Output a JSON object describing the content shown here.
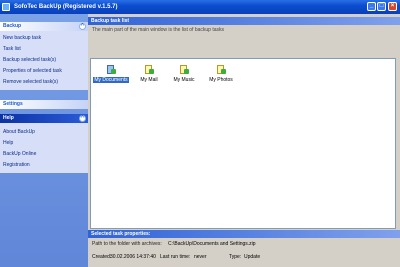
{
  "window": {
    "title": "SofoTec BackUp (Registered v.1.5.7)",
    "min_glyph": "_",
    "max_glyph": "□",
    "close_glyph": "×"
  },
  "sidebar": {
    "backup_panel": {
      "header": "Backup",
      "collapse_glyph": "^",
      "items": [
        "New backup task",
        "Task list",
        "Backup selected task(s)",
        "Properties of selected task",
        "Remove selected task(s)"
      ]
    },
    "settings_panel": {
      "header": "Settings"
    },
    "help_panel": {
      "header": "Help",
      "collapse_glyph": "^",
      "items": [
        "About BackUp",
        "Help",
        "BackUp Online",
        "Registration"
      ]
    }
  },
  "main": {
    "header": "Backup task list",
    "hint": "The main part of the main window is the list of backup tasks",
    "tasks": [
      {
        "name": "My Documents",
        "icon": "backup-doc-icon",
        "selected": true
      },
      {
        "name": "My Mail",
        "icon": "backup-doc-icon",
        "selected": false
      },
      {
        "name": "My Music",
        "icon": "backup-doc-icon",
        "selected": false
      },
      {
        "name": "My Photos",
        "icon": "backup-doc-icon",
        "selected": false
      }
    ]
  },
  "properties": {
    "header": "Selected task properties:",
    "path_label": "Path to the folder with archives:",
    "path_value": "C:\\BackUp\\Documents and Settings.zip",
    "created_label": "Created:",
    "created_value": "30.02.2006 14:37:40",
    "last_run_label": "Last run time:",
    "last_run_value": "never",
    "type_label": "Type:",
    "type_value": "Update"
  },
  "colors": {
    "title_bar": "#0a4ed0",
    "sidebar": "#6c92e0",
    "selection": "#316ac5"
  }
}
